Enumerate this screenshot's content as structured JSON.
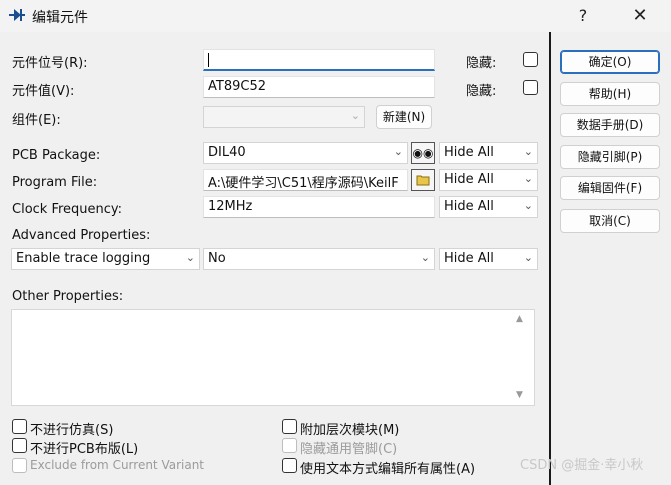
{
  "window": {
    "title": "编辑元件",
    "help_label": "?",
    "close_label": "✕",
    "icon": "component-icon"
  },
  "fields": {
    "ref_label": "元件位号(R):",
    "ref_value": "",
    "hidden_label_1": "隐藏:",
    "value_label": "元件值(V):",
    "value_value": "AT89C52",
    "hidden_label_2": "隐藏:",
    "group_label": "组件(E):",
    "group_value": "",
    "new_button": "新建(N)"
  },
  "properties": {
    "pcb_package_label": "PCB Package:",
    "pcb_package_value": "DIL40",
    "pcb_hide": "Hide All",
    "program_file_label": "Program File:",
    "program_file_value": "A:\\硬件学习\\C51\\程序源码\\KeilF",
    "program_hide": "Hide All",
    "clock_label": "Clock Frequency:",
    "clock_value": "12MHz",
    "clock_hide": "Hide All",
    "advanced_label": "Advanced Properties:",
    "advanced_prop": "Enable trace logging",
    "advanced_value": "No",
    "advanced_hide": "Hide All",
    "other_label": "Other Properties:",
    "other_value": ""
  },
  "buttons": {
    "ok": "确定(O)",
    "help": "帮助(H)",
    "datasheet": "数据手册(D)",
    "hidden_pins": "隐藏引脚(P)",
    "edit_firmware": "编辑固件(F)",
    "cancel": "取消(C)"
  },
  "options": {
    "exclude_sim": "不进行仿真(S)",
    "exclude_pcb": "不进行PCB布版(L)",
    "exclude_variant": "Exclude from Current Variant",
    "attach_hier": "附加层次模块(M)",
    "hide_common_pins": "隐藏通用管脚(C)",
    "edit_all_text": "使用文本方式编辑所有属性(A)"
  },
  "watermark": "CSDN @掘金·幸小秋"
}
